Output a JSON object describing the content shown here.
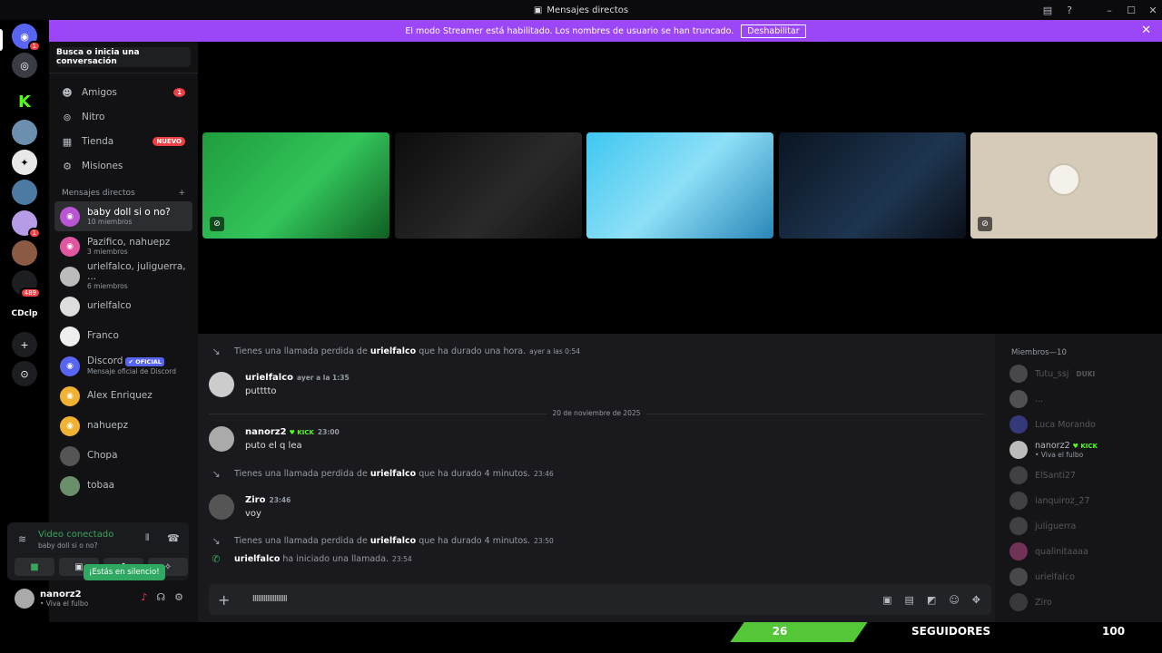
{
  "window": {
    "title": "Mensajes directos"
  },
  "banner": {
    "text": "El modo Streamer está habilitado. Los nombres de usuario se han truncado.",
    "button": "Deshabilitar"
  },
  "guilds": {
    "home_badge": "1",
    "folder_badge": "1",
    "badge_489": "489",
    "cdclp": "CDclp"
  },
  "sidebar": {
    "search_placeholder": "Busca o inicia una conversación",
    "nav": [
      {
        "label": "Amigos",
        "badge": "1"
      },
      {
        "label": "Nitro"
      },
      {
        "label": "Tienda",
        "badge": "NUEVO"
      },
      {
        "label": "Misiones"
      }
    ],
    "dm_header": "Mensajes directos",
    "dms": [
      {
        "name": "baby doll si o no?",
        "sub": "10 miembros"
      },
      {
        "name": "Pazifico, nahuepz",
        "sub": "3 miembros"
      },
      {
        "name": "urielfalco, juliguerra, ...",
        "sub": "6 miembros"
      },
      {
        "name": "urielfalco"
      },
      {
        "name": "Franco"
      },
      {
        "name": "Discord",
        "badge": "✔ OFICIAL",
        "sub": "Mensaje oficial de Discord"
      },
      {
        "name": "Alex Enriquez"
      },
      {
        "name": "nahuepz"
      },
      {
        "name": "Chopa"
      },
      {
        "name": "tobaa"
      }
    ]
  },
  "voice": {
    "status": "Video conectado",
    "channel": "baby doll si o no?",
    "tooltip": "¡Estás en silencio!"
  },
  "user": {
    "name": "nanorz2",
    "status": "• Viva el fulbo"
  },
  "chat": {
    "missed1": {
      "pre": "Tienes una llamada perdida de ",
      "who": "urielfalco",
      "post": " que ha durado una hora.",
      "ts": "ayer a las 0:54"
    },
    "msg1": {
      "author": "urielfalco",
      "ts": "ayer a la 1:35",
      "text": "putttto"
    },
    "date_divider": "20 de noviembre de 2025",
    "msg2": {
      "author": "nanorz2",
      "kick": "KICK",
      "ts": "23:00",
      "text": "puto el q lea"
    },
    "missed2": {
      "pre": "Tienes una llamada perdida de ",
      "who": "urielfalco",
      "post": " que ha durado 4 minutos.",
      "ts": "23:46"
    },
    "msg3": {
      "author": "Ziro",
      "ts": "23:46",
      "text": "voy"
    },
    "missed3": {
      "pre": "Tienes una llamada perdida de ",
      "who": "urielfalco",
      "post": " que ha durado 4 minutos.",
      "ts": "23:50"
    },
    "started": {
      "who": "urielfalco",
      "post": " ha iniciado una llamada.",
      "ts": "23:54"
    },
    "composer_value": "lllllllllllllllllll"
  },
  "members": {
    "header": "Miembros—10",
    "list": [
      {
        "name": "Tutu_ssj",
        "tag": "DUKI"
      },
      {
        "name": "..."
      },
      {
        "name": "Luca Morando"
      },
      {
        "name": "nanorz2",
        "tag": "KICK",
        "status": "• Viva el fulbo"
      },
      {
        "name": "ElSanti27"
      },
      {
        "name": "ianquiroz_27"
      },
      {
        "name": "juliguerra"
      },
      {
        "name": "qualinitaaaa"
      },
      {
        "name": "urielfalco"
      },
      {
        "name": "Ziro"
      }
    ]
  },
  "overlay": {
    "current": "26",
    "label": "SEGUIDORES",
    "goal": "100"
  },
  "colors": {
    "accent": "#9c47f7",
    "green": "#53c738",
    "kick": "#53fc18",
    "blurple": "#5865f2"
  }
}
